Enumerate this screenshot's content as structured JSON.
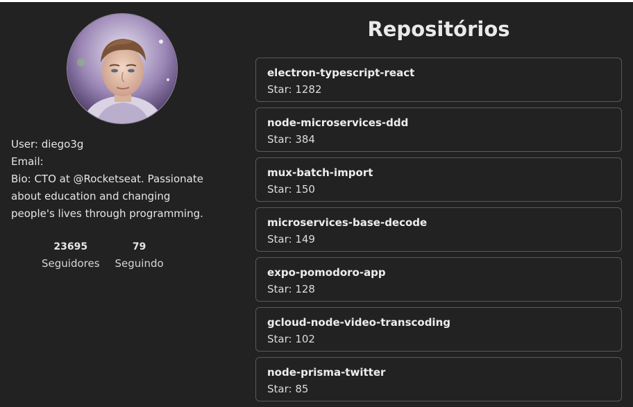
{
  "profile": {
    "user_line": "User: diego3g",
    "email_line": "Email:",
    "bio_line_1": "Bio: CTO at @Rocketseat. Passionate",
    "bio_line_2": "about education and changing",
    "bio_line_3": "people's lives through programming.",
    "avatar_icon": "user-avatar-photo"
  },
  "stats": {
    "followers_count": "23695",
    "followers_label": "Seguidores",
    "following_count": "79",
    "following_label": "Seguindo"
  },
  "repositories": {
    "title": "Repositórios",
    "items": [
      {
        "name": "electron-typescript-react",
        "stars": "Star: 1282"
      },
      {
        "name": "node-microservices-ddd",
        "stars": "Star: 384"
      },
      {
        "name": "mux-batch-import",
        "stars": "Star: 150"
      },
      {
        "name": "microservices-base-decode",
        "stars": "Star: 149"
      },
      {
        "name": "expo-pomodoro-app",
        "stars": "Star: 128"
      },
      {
        "name": "gcloud-node-video-transcoding",
        "stars": "Star: 102"
      },
      {
        "name": "node-prisma-twitter",
        "stars": "Star: 85"
      }
    ]
  },
  "colors": {
    "background": "#222222",
    "card_border": "#5a5a5a",
    "text": "#e6e6e6"
  }
}
